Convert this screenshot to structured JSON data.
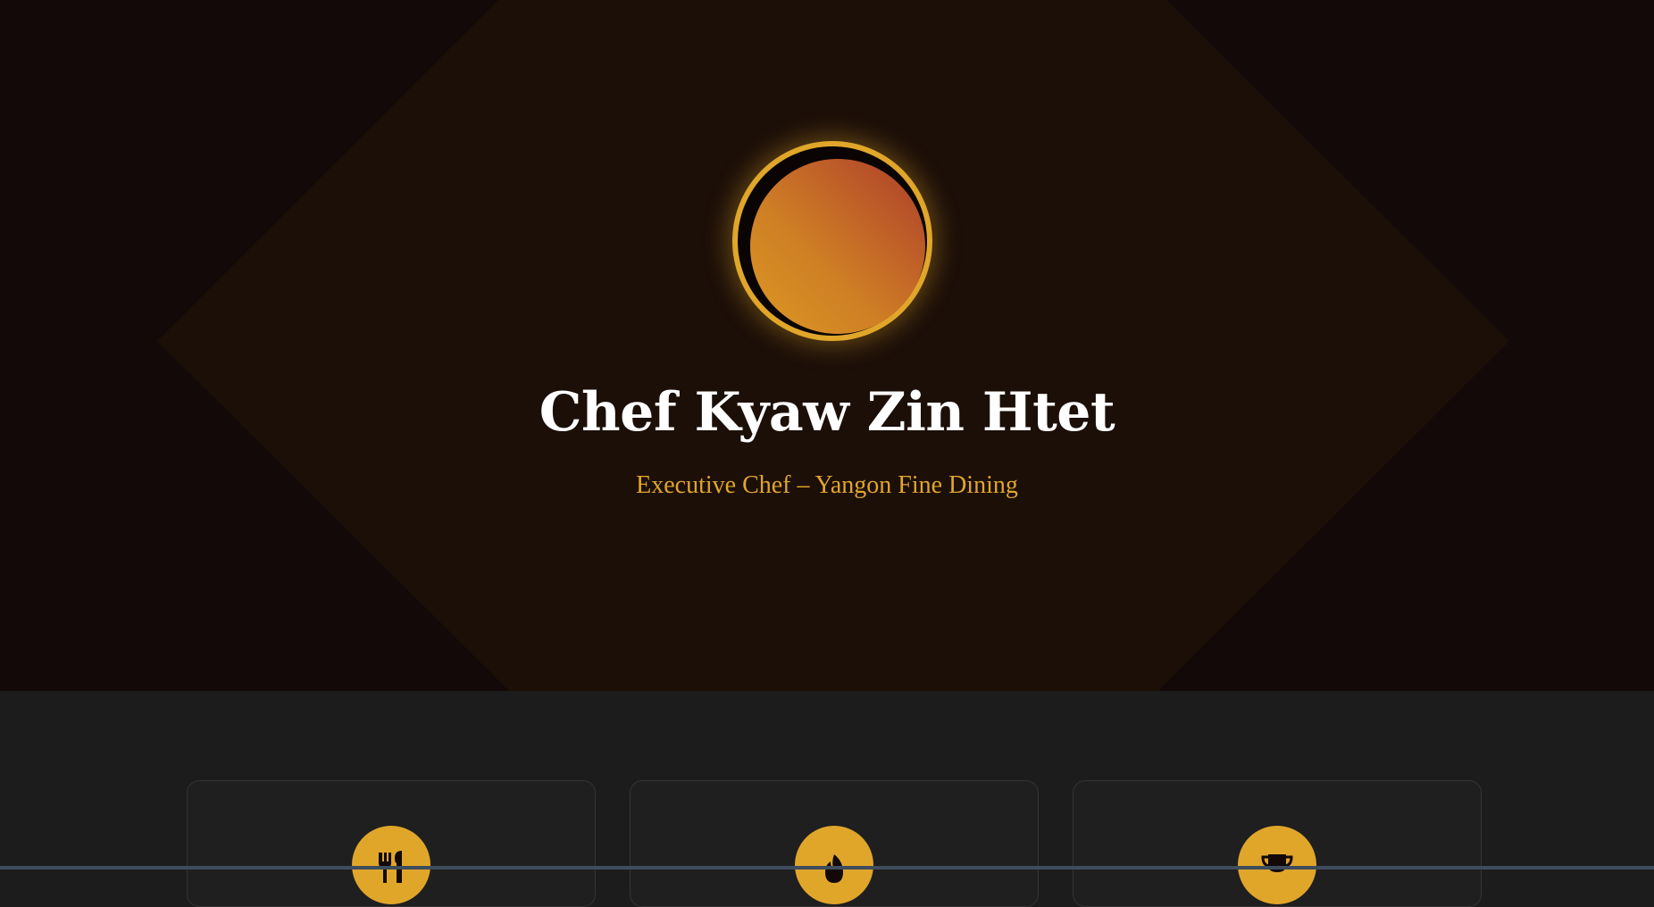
{
  "hero": {
    "chef_name": "Chef Kyaw Zin Htet",
    "chef_title": "Executive Chef – Yangon Fine Dining"
  },
  "cards": [
    {
      "icon": "utensils-icon"
    },
    {
      "icon": "fire-icon"
    },
    {
      "icon": "trophy-icon"
    }
  ],
  "colors": {
    "accent": "#e0a62a",
    "hero_bg": "#120908",
    "diamond_bg": "#1c0f08",
    "section_bg": "#1c1c1c"
  }
}
